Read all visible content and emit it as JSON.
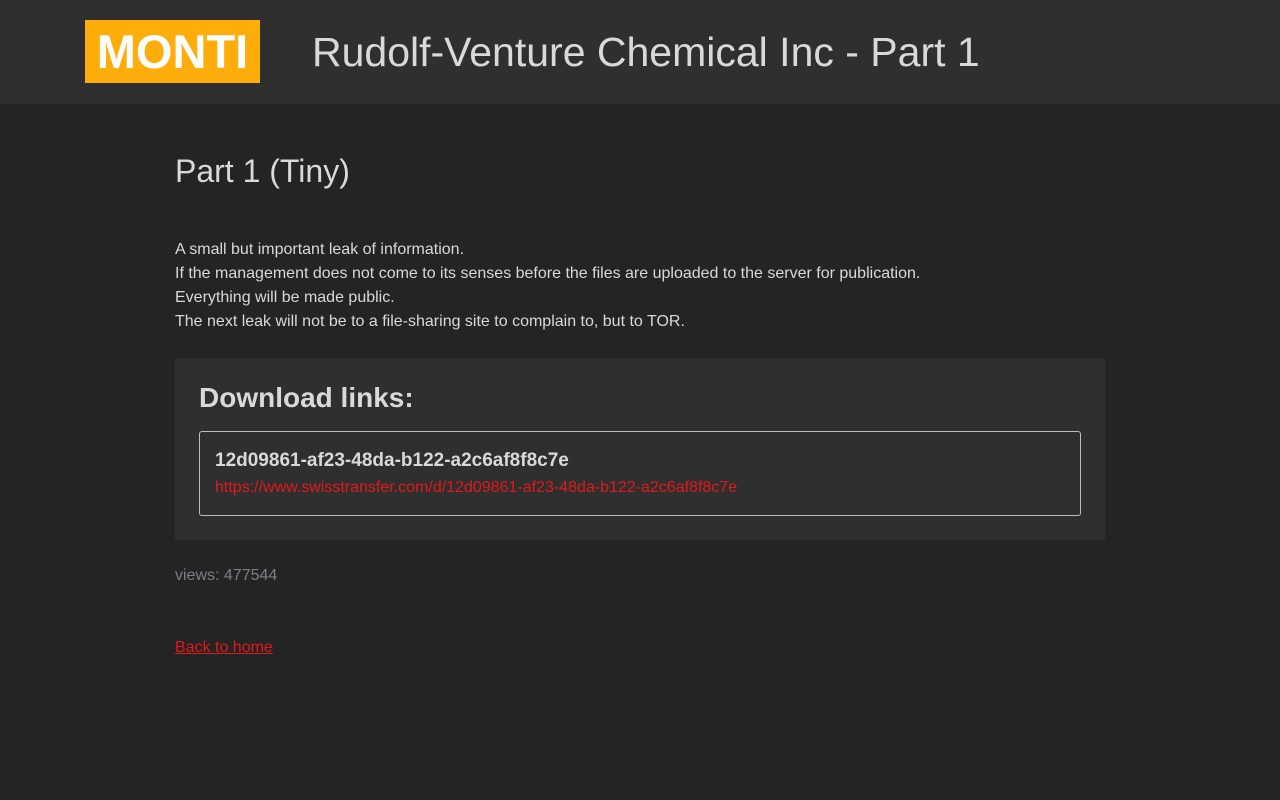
{
  "header": {
    "logo_text": "MONTI",
    "site_title": "Rudolf-Venture Chemical Inc - Part 1"
  },
  "main": {
    "page_title": "Part 1 (Tiny)",
    "description_lines": [
      "A small but important leak of information.",
      "If the management does not come to its senses before the files are uploaded to the server for publication.",
      "Everything will be made public.",
      "The next leak will not be to a file-sharing site to complain to, but to TOR."
    ],
    "downloads": {
      "heading": "Download links:",
      "items": [
        {
          "name": "12d09861-af23-48da-b122-a2c6af8f8c7e",
          "url": "https://www.swisstransfer.com/d/12d09861-af23-48da-b122-a2c6af8f8c7e"
        }
      ]
    },
    "views_text": "views: 477544",
    "back_link": "Back to home"
  },
  "colors": {
    "background": "#242424",
    "header_background": "#2f2f2f",
    "logo_background": "#ffad0a",
    "link_red": "#e0191b",
    "text": "#d9d9d9",
    "muted_text": "#7c7f85"
  }
}
